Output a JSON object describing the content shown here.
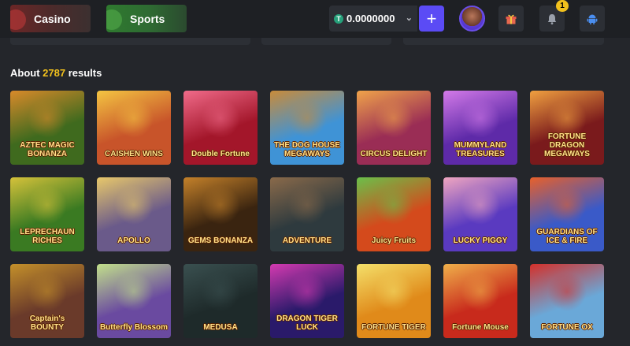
{
  "header": {
    "casino_label": "Casino",
    "sports_label": "Sports",
    "balance": "0.0000000",
    "notification_count": "1"
  },
  "results": {
    "prefix": "About",
    "count": "2787",
    "suffix": "results"
  },
  "games": [
    {
      "name": "AZTEC MAGIC BONANZA",
      "bg": "#3f6a1e",
      "glow": "#d98a2a"
    },
    {
      "name": "CAISHEN WINS",
      "bg": "#c8542a",
      "glow": "#f4c542"
    },
    {
      "name": "Double Fortune",
      "bg": "#a3162a",
      "glow": "#f06b8a"
    },
    {
      "name": "THE DOG HOUSE MEGAWAYS",
      "bg": "#3f93d6",
      "glow": "#c98b3a"
    },
    {
      "name": "CIRCUS DELIGHT",
      "bg": "#9a2d55",
      "glow": "#f0a34a"
    },
    {
      "name": "MUMMYLAND TREASURES",
      "bg": "#5e2aa8",
      "glow": "#d37ae8"
    },
    {
      "name": "FORTUNE DRAGON MEGAWAYS",
      "bg": "#7a1a1c",
      "glow": "#f0a040"
    },
    {
      "name": "LEPRECHAUN RICHES",
      "bg": "#3a7a22",
      "glow": "#d6c23a"
    },
    {
      "name": "APOLLO",
      "bg": "#6a5a8a",
      "glow": "#e8c86a"
    },
    {
      "name": "GEMS BONANZA",
      "bg": "#3a2410",
      "glow": "#c4812a"
    },
    {
      "name": "ADVENTURE",
      "bg": "#2e3a3e",
      "glow": "#8a6a4a"
    },
    {
      "name": "Juicy Fruits",
      "bg": "#d44a1c",
      "glow": "#6ac04a"
    },
    {
      "name": "LUCKY PIGGY",
      "bg": "#5a3ac0",
      "glow": "#f0a6c0"
    },
    {
      "name": "GUARDIANS OF ICE & FIRE",
      "bg": "#3a5ac8",
      "glow": "#e8602a"
    },
    {
      "name": "Captain's BOUNTY",
      "bg": "#6a3a2a",
      "glow": "#c4902a"
    },
    {
      "name": "Butterfly Blossom",
      "bg": "#6a4aa0",
      "glow": "#c2e08a"
    },
    {
      "name": "MEDUSA",
      "bg": "#1e2a2a",
      "glow": "#3a5050"
    },
    {
      "name": "DRAGON TIGER LUCK",
      "bg": "#2a1a6a",
      "glow": "#d43ab0"
    },
    {
      "name": "FORTUNE TIGER",
      "bg": "#e08a1a",
      "glow": "#f4e06a"
    },
    {
      "name": "Fortune Mouse",
      "bg": "#c82a1c",
      "glow": "#f0b04a"
    },
    {
      "name": "FORTUNE OX",
      "bg": "#6aa8d8",
      "glow": "#d4302a"
    }
  ]
}
